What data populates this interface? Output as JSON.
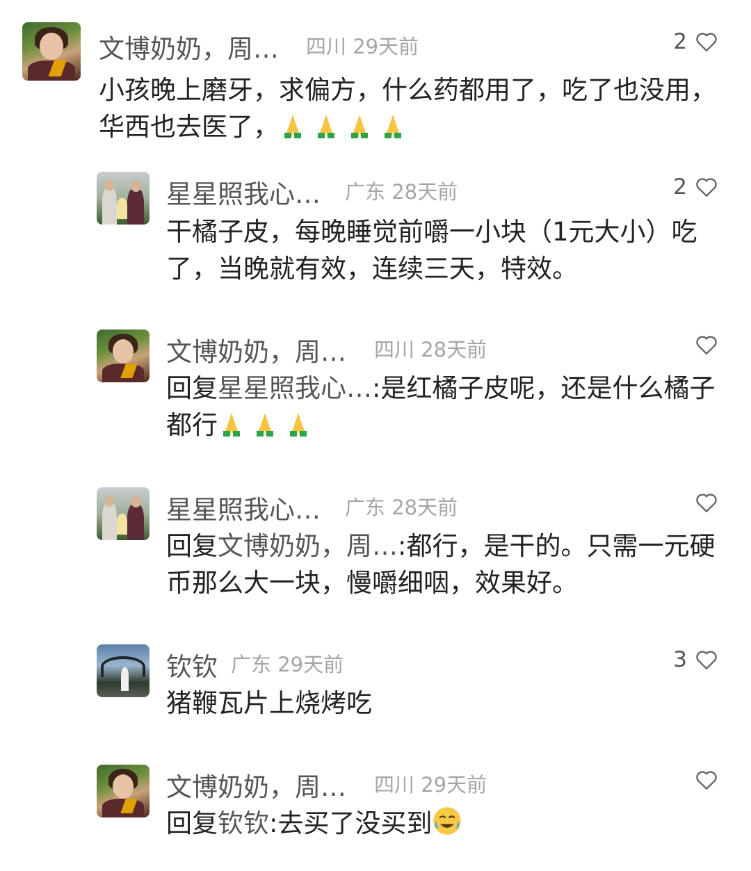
{
  "comments": [
    {
      "user": "文博奶奶，周…",
      "location": "四川",
      "time": "29天前",
      "likes": "2",
      "text": "小孩晚上磨牙，求偏方，什么药都用了，吃了也没用，华西也去医了，",
      "emoji": "folded-hands-emoji",
      "emoji_count": 4
    },
    {
      "user": "星星照我心…",
      "location": "广东",
      "time": "28天前",
      "likes": "2",
      "text": "干橘子皮，每晚睡觉前嚼一小块（1元大小）吃了，当晚就有效，连续三天，特效。"
    },
    {
      "user": "文博奶奶，周…",
      "location": "四川",
      "time": "28天前",
      "likes": "",
      "reply_prefix": "回复",
      "reply_to": "星星照我心…",
      "text": ":是红橘子皮呢，还是什么橘子都行",
      "emoji": "folded-hands-emoji",
      "emoji_count": 3
    },
    {
      "user": "星星照我心…",
      "location": "广东",
      "time": "28天前",
      "likes": "",
      "reply_prefix": "回复",
      "reply_to": "文博奶奶，周…",
      "text": ":都行，是干的。只需一元硬币那么大一块，慢嚼细咽，效果好。"
    },
    {
      "user": "钦钦",
      "location": "广东",
      "time": "29天前",
      "likes": "3",
      "text": "猪鞭瓦片上烧烤吃"
    },
    {
      "user": "文博奶奶，周…",
      "location": "四川",
      "time": "29天前",
      "likes": "",
      "reply_prefix": "回复",
      "reply_to": "钦钦",
      "text": ":去买了没买到",
      "emoji": "laughing-crying-emoji",
      "emoji_count": 1
    }
  ],
  "colors": {
    "name": "#555555",
    "meta": "#a5a5a5",
    "text": "#222222",
    "heart": "#666666"
  }
}
